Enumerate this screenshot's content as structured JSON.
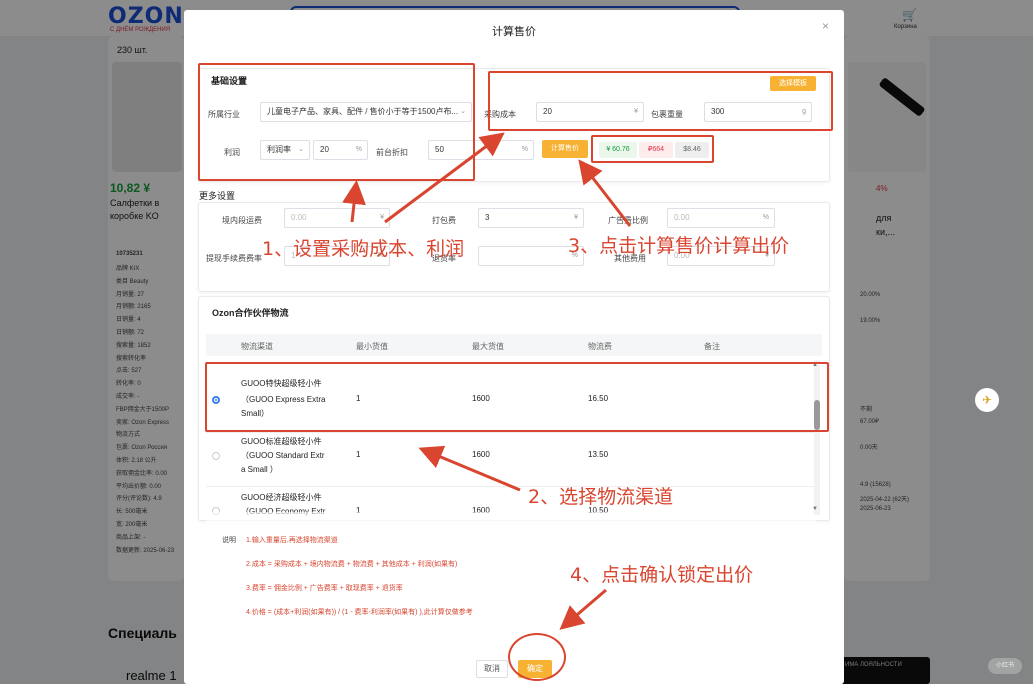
{
  "background": {
    "logo": "OZON",
    "logo_sub": "С ДНЁМ РОЖДЕНИЯ",
    "qty": "230 шт.",
    "price_left": "10,82 ¥",
    "desc_left_1": "Салфетки в",
    "desc_left_2": "коробке KO",
    "sku_left": "10735231",
    "pct_right": "4%",
    "desc_right_1": "для",
    "desc_right_2": "ки,...",
    "special": "Специаль",
    "realme": "realme 1",
    "banner_text": "ИМА ЛОЯЛЬНОСТИ",
    "cart_label": "Корзина",
    "left_details": [
      "品牌 KIX",
      "类目 Beauty",
      "月销量: 27",
      "月销额: 2165",
      "日销量: 4",
      "日销额: 72",
      "搜索量: 1852",
      "搜索转化率",
      "点击: 527",
      "转化率: 0",
      "成交率: -",
      "FBP佣金大于1500P",
      "卖家: Ozon Express",
      "物流方式",
      "包裹: Ozon Россия",
      "体积: 2.18 公升",
      "获取佣金比率: 0.00",
      "平均出价额: 0.00",
      "评分(评论数): 4.9",
      "长: 500毫米",
      "宽: 200毫米",
      "商品上架: -",
      "数据更新: 2025-06-23"
    ],
    "right_details": [
      "20.00%",
      "19.00%",
      "不剩",
      "67.00₽",
      "0.00天",
      "4.9 (15628)",
      "2025-04-22 (62天)",
      "2025-06-23"
    ]
  },
  "modal": {
    "title": "计算售价",
    "close": "×",
    "basic": {
      "title": "基础设置",
      "industry_label": "所属行业",
      "industry_value": "儿童电子产品、家具、配件 / 售价小于等于1500卢布...",
      "profit_label": "利润",
      "profit_type": "利润率",
      "profit_value": "20",
      "profit_unit": "%",
      "discount_label": "前台折扣",
      "discount_value": "50",
      "discount_unit": "%",
      "cost_label": "采购成本",
      "cost_value": "20",
      "cost_unit": "¥",
      "weight_label": "包裹重量",
      "weight_value": "300",
      "weight_unit": "g",
      "template_btn": "选择模板",
      "calc_btn": "计算售价",
      "result_cny": "¥ 60.76",
      "result_rub": "₽664",
      "result_usd": "$8.46"
    },
    "more": {
      "title": "更多设置",
      "domestic_label": "境内段运费",
      "domestic_placeholder": "0.00",
      "domestic_unit": "¥",
      "packing_label": "打包费",
      "packing_value": "3",
      "packing_unit": "¥",
      "ad_label": "广告费比例",
      "ad_placeholder": "0.00",
      "ad_unit": "%",
      "withdraw_label": "提现手续费费率",
      "withdraw_placeholder": "1",
      "withdraw_unit": "%",
      "return_label": "退货率",
      "return_unit": "%",
      "other_label": "其他费用",
      "other_placeholder": "0.00",
      "other_unit": "¥"
    },
    "logistics": {
      "title": "Ozon合作伙伴物流",
      "columns": [
        "物流渠道",
        "最小货值",
        "最大货值",
        "物流费",
        "备注"
      ],
      "rows": [
        {
          "name1": "GUOO特快超级轻小件",
          "name2": "（GUOO Express Extra",
          "name3": "Small）",
          "min": "1",
          "max": "1600",
          "fee": "16.50",
          "selected": true
        },
        {
          "name1": "GUOO标准超级轻小件",
          "name2": "（GUOO Standard Extr",
          "name3": "a Small ）",
          "min": "1",
          "max": "1600",
          "fee": "13.50",
          "selected": false
        },
        {
          "name1": "GUOO经济超级轻小件",
          "name2": "（GUOO Economy Extr",
          "name3": "",
          "min": "1",
          "max": "1600",
          "fee": "10.50",
          "selected": false
        }
      ]
    },
    "notes": {
      "label": "说明",
      "items": [
        "1.输入重量后,再选择物流渠道",
        "2.成本 = 采购成本 + 境内物流费 + 物流费 + 其他成本 + 利润(如果有)",
        "3.费率 = 佣金比例 + 广告费率 + 取现费率 + 退货率",
        "4.价格 = (成本+利润(如果有)) / (1 - 费率-利润率(如果有) ),此计算仅做参考"
      ]
    },
    "cancel": "取消",
    "confirm": "确定"
  },
  "annotations": {
    "step1": "1、设置采购成本、利润",
    "step2": "2、选择物流渠道",
    "step3": "3、点击计算售价计算出价",
    "step4": "4、点击确认锁定出价"
  },
  "colors": {
    "accent": "#f7b233",
    "annotation": "#d9452f",
    "radio": "#3a7ff0",
    "price_green": "#14a03c"
  },
  "watermark": "小红书"
}
